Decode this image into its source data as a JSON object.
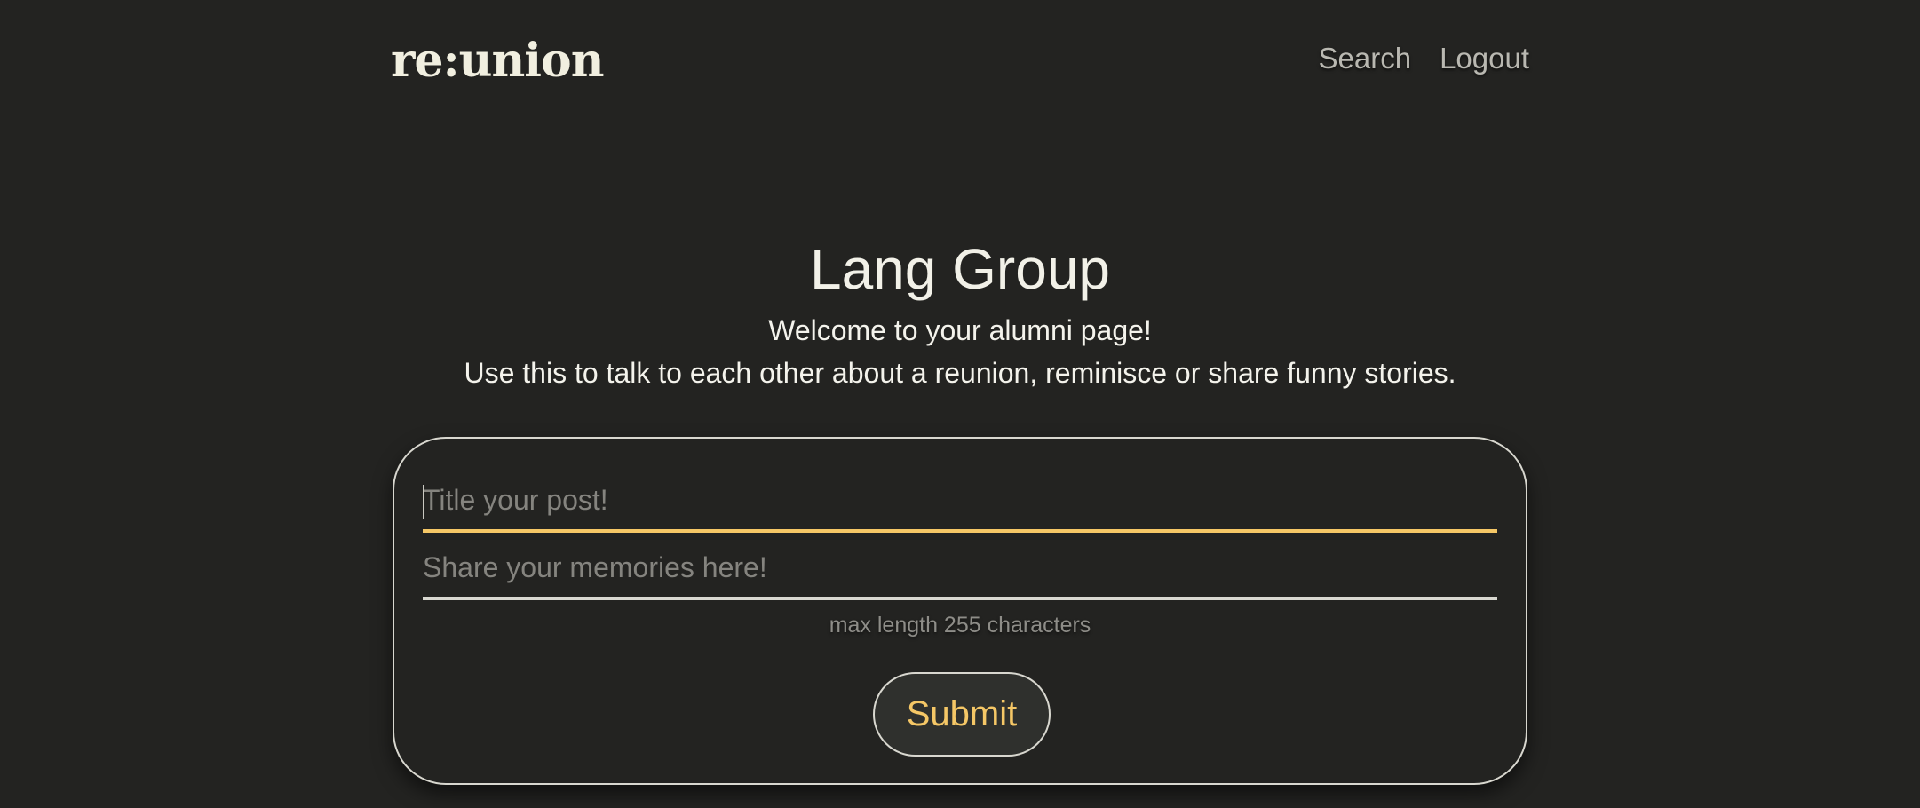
{
  "nav": {
    "logo": "re:union",
    "links": [
      "Search",
      "Logout"
    ]
  },
  "hero": {
    "title": "Lang Group",
    "welcome": "Welcome to your alumni page!",
    "description": "Use this to talk to each other about a reunion, reminisce or share funny stories."
  },
  "form": {
    "title_placeholder": "Title your post!",
    "title_value": "",
    "body_placeholder": "Share your memories here!",
    "body_value": "",
    "hint": "max length 255 characters",
    "submit_label": "Submit"
  },
  "colors": {
    "background": "#232321",
    "accent": "#f5c766",
    "text": "#f2f1e8"
  }
}
